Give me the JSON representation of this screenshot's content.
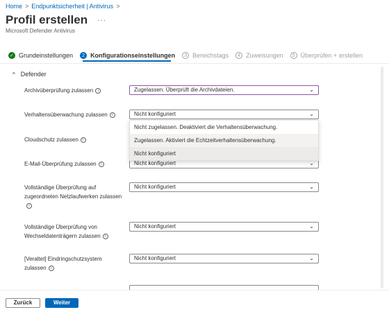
{
  "breadcrumb": {
    "home": "Home",
    "endpoint": "Endpunktsicherheit | Antivirus"
  },
  "header": {
    "title": "Profil erstellen",
    "subtitle": "Microsoft Defender Antivirus",
    "more": "···"
  },
  "steps": [
    {
      "number": "✓",
      "label": "Grundeinstellungen"
    },
    {
      "number": "2",
      "label": "Konfigurationseinstellungen"
    },
    {
      "number": "3",
      "label": "Bereichstags"
    },
    {
      "number": "4",
      "label": "Zuweisungen"
    },
    {
      "number": "5",
      "label": "Überprüfen + erstellen"
    }
  ],
  "section": {
    "chevron": "^",
    "title": "Defender"
  },
  "settings": [
    {
      "label": "Archivüberprüfung zulassen",
      "value": "Zugelassen. Überprüft die Archivdateien."
    },
    {
      "label": "Verhaltensüberwachung zulassen",
      "value": "Nicht konfiguriert"
    },
    {
      "label": "Cloudschutz zulassen",
      "value": ""
    },
    {
      "label": "E-Mail-Überprüfung zulassen",
      "value": "Nicht konfiguriert"
    },
    {
      "label": "Vollständige Überprüfung auf zugeordneten Netzlaufwerken zulassen",
      "value": "Nicht konfiguriert"
    },
    {
      "label": "Vollständige Überprüfung von Wechseldatenträgern zulassen",
      "value": "Nicht konfiguriert"
    },
    {
      "label": "[Veraltet] Eindringschutzsystem zulassen",
      "value": "Nicht konfiguriert"
    }
  ],
  "menu": {
    "options": [
      "Nicht zugelassen. Deaktiviert die Verhaltensüberwachung.",
      "Zugelassen. Aktiviert die Echtzeitverhaltensüberwachung.",
      "Nicht konfiguriert"
    ]
  },
  "icons": {
    "info": "i",
    "caret": "⌄"
  },
  "footer": {
    "back": "Zurück",
    "next": "Weiter"
  },
  "colors": {
    "accent": "#0067b8",
    "done": "#107c10",
    "focus": "#8a56ab"
  }
}
